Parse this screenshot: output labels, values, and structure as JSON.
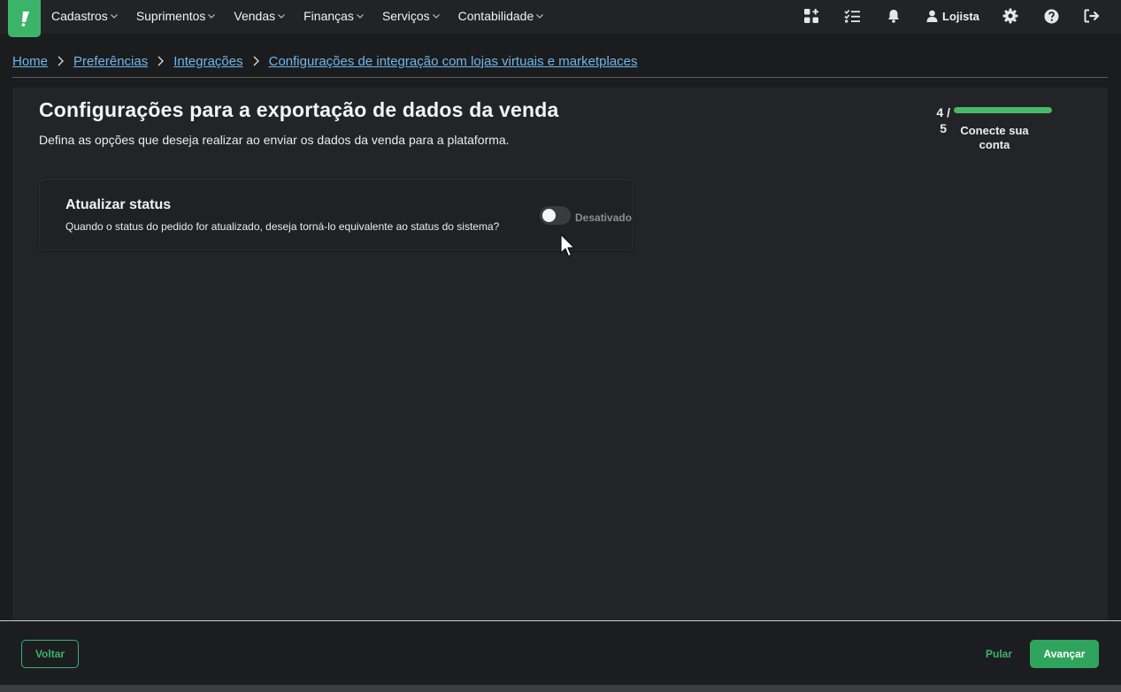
{
  "colors": {
    "accent": "#3bb46a",
    "link": "#6fb6ec",
    "panel_bg": "#232427",
    "topbar_bg": "#222326"
  },
  "topbar": {
    "logo_icon": "brand-logo-icon",
    "menu": [
      {
        "label": "Cadastros"
      },
      {
        "label": "Suprimentos"
      },
      {
        "label": "Vendas"
      },
      {
        "label": "Finanças"
      },
      {
        "label": "Serviços"
      },
      {
        "label": "Contabilidade"
      }
    ],
    "icons": [
      "apps-add-icon",
      "checklist-icon",
      "bell-icon",
      "user-icon",
      "gear-icon",
      "help-icon",
      "logout-icon"
    ],
    "user_label": "Lojista"
  },
  "breadcrumb": [
    {
      "label": "Home"
    },
    {
      "label": "Preferências"
    },
    {
      "label": "Integrações"
    },
    {
      "label": "Configurações de integração com lojas virtuais e marketplaces"
    }
  ],
  "page": {
    "title": "Configurações para a exportação de dados da venda",
    "subtitle": "Defina as opções que deseja realizar ao enviar os dados da venda para a plataforma."
  },
  "stepper": {
    "current": "4 /",
    "total": "5",
    "progress": 1.0,
    "label": "Conecte sua conta"
  },
  "setting": {
    "title": "Atualizar status",
    "description": "Quando o status do pedido for atualizado, deseja torná-lo equivalente ao status do sistema?",
    "enabled": false,
    "state_label": "Desativado"
  },
  "footer": {
    "back_label": "Voltar",
    "skip_label": "Pular",
    "next_label": "Avançar"
  }
}
